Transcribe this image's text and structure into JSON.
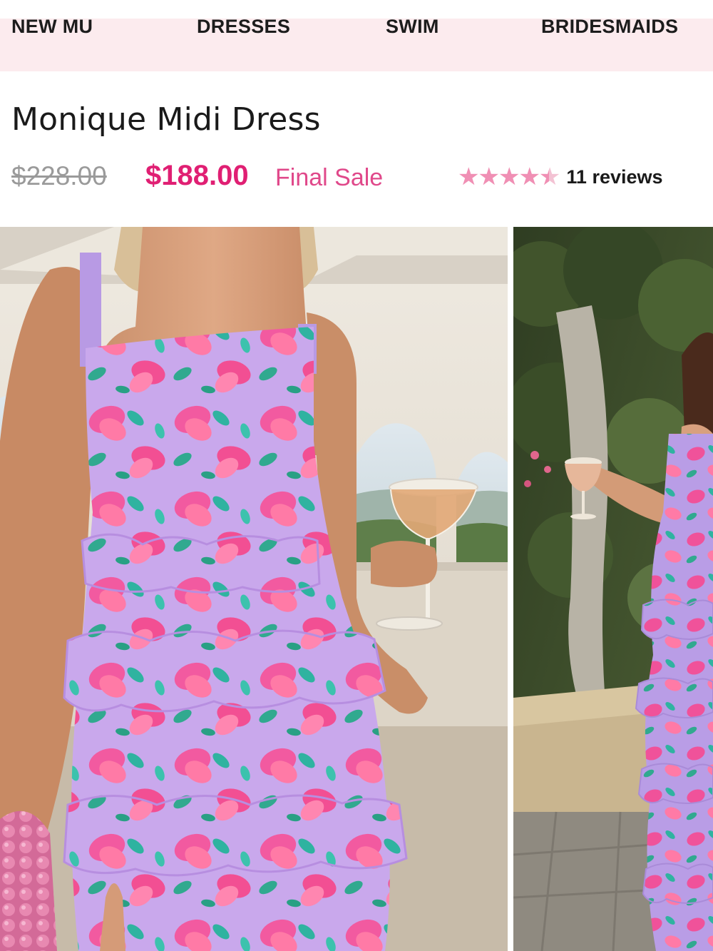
{
  "nav": {
    "items": [
      {
        "label": "NEW MU"
      },
      {
        "label": "DRESSES"
      },
      {
        "label": "SWIM"
      },
      {
        "label": "BRIDESMAIDS"
      }
    ]
  },
  "product": {
    "title": "Monique Midi Dress",
    "price_original": "$228.00",
    "price_sale": "$188.00",
    "sale_note": "Final Sale",
    "rating_value": 4.5,
    "rating_max": 5,
    "reviews_label": "11 reviews"
  },
  "colors": {
    "accent_pink": "#e01f73",
    "nav_background": "#fcebee",
    "star_color": "#f08fb4"
  },
  "gallery": {
    "images": [
      {
        "name": "model-front-closeup-photo"
      },
      {
        "name": "model-full-length-garden-photo"
      }
    ]
  }
}
